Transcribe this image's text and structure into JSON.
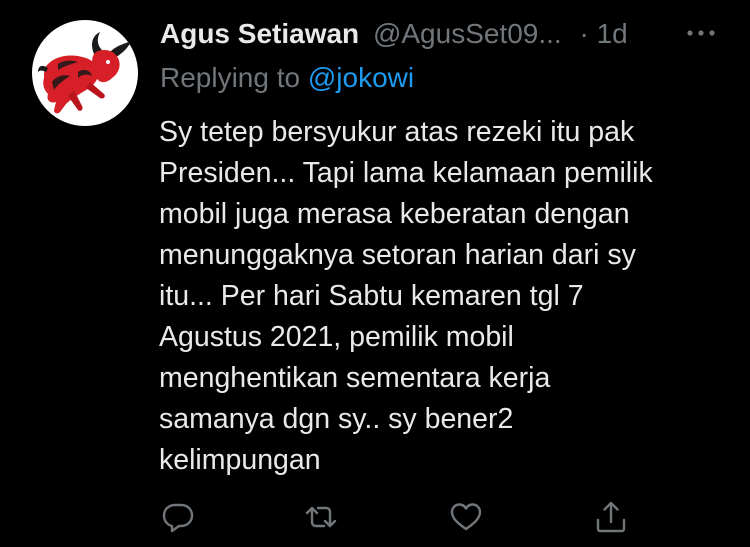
{
  "tweet": {
    "display_name": "Agus Setiawan",
    "handle": "@AgusSet09...",
    "separator": "·",
    "timestamp": "1d",
    "replying_prefix": "Replying to ",
    "replying_to": "@jokowi",
    "text_lines": [
      "Sy tetep bersyukur atas rezeki itu pak",
      "Presiden... Tapi lama kelamaan pemilik",
      "mobil juga merasa keberatan dengan",
      "menunggaknya setoran harian dari sy",
      "itu... Per hari Sabtu kemaren tgl 7",
      "Agustus 2021, pemilik mobil",
      "menghentikan sementara kerja",
      "samanya dgn sy.. sy bener2",
      "kelimpungan"
    ],
    "avatar_icon": "red-bull-logo-icon",
    "actions": [
      "reply-icon",
      "retweet-icon",
      "like-icon",
      "share-icon"
    ]
  },
  "colors": {
    "background": "#000000",
    "primary_text": "#e7e9ea",
    "secondary_text": "#71767b",
    "link": "#1d9bf0",
    "avatar_bull": "#d61f26"
  }
}
